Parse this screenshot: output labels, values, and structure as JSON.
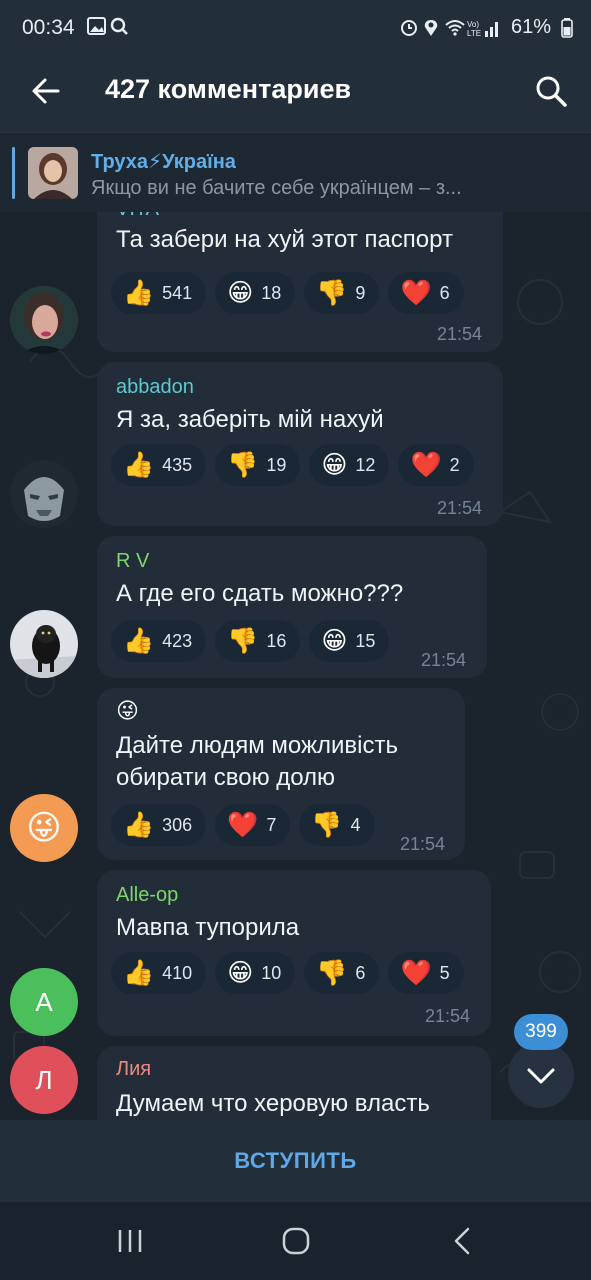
{
  "status": {
    "time": "00:34",
    "battery": "61%",
    "network": "LTE"
  },
  "header": {
    "title": "427 комментариев"
  },
  "pinned": {
    "channel": "Труха⚡Україна",
    "text": "Якщо ви не бачите себе українцем – з..."
  },
  "messages": [
    {
      "sender": "VITA",
      "sender_color": "#6cc8e0",
      "text": [
        "Та забери на хуй этот паспорт"
      ],
      "time": "21:54",
      "reactions": [
        {
          "emoji": "👍",
          "count": "541"
        },
        {
          "emoji": "😁",
          "count": "18"
        },
        {
          "emoji": "👎",
          "count": "9"
        },
        {
          "emoji": "❤️",
          "count": "6"
        }
      ]
    },
    {
      "sender": "abbadon",
      "sender_color": "#5fc8cf",
      "text": [
        "Я за, заберіть мій нахуй"
      ],
      "time": "21:54",
      "reactions": [
        {
          "emoji": "👍",
          "count": "435"
        },
        {
          "emoji": "👎",
          "count": "19"
        },
        {
          "emoji": "😁",
          "count": "12"
        },
        {
          "emoji": "❤️",
          "count": "2"
        }
      ]
    },
    {
      "sender": "R V",
      "sender_color": "#7ed66a",
      "text": [
        "А где его сдать можно???"
      ],
      "time": "21:54",
      "reactions": [
        {
          "emoji": "👍",
          "count": "423"
        },
        {
          "emoji": "👎",
          "count": "16"
        },
        {
          "emoji": "😁",
          "count": "15"
        }
      ]
    },
    {
      "sender": "😜",
      "sender_color": "#ffffff",
      "text": [
        "Дайте людям можливість",
        "обирати свою долю"
      ],
      "time": "21:54",
      "reactions": [
        {
          "emoji": "👍",
          "count": "306"
        },
        {
          "emoji": "❤️",
          "count": "7"
        },
        {
          "emoji": "👎",
          "count": "4"
        }
      ]
    },
    {
      "sender": "Alle-op",
      "sender_color": "#7ed66a",
      "text": [
        "Мавпа тупорила"
      ],
      "time": "21:54",
      "reactions": [
        {
          "emoji": "👍",
          "count": "410"
        },
        {
          "emoji": "😁",
          "count": "10"
        },
        {
          "emoji": "👎",
          "count": "6"
        },
        {
          "emoji": "❤️",
          "count": "5"
        }
      ]
    },
    {
      "sender": "Лия",
      "sender_color": "#f08a7e",
      "text": [
        "Думаем что херовую власть"
      ],
      "time": "",
      "reactions": []
    }
  ],
  "avatars": {
    "a": "A",
    "l": "Л",
    "emoji": "😜"
  },
  "scroll": {
    "unread": "399"
  },
  "footer": {
    "join": "ВСТУПИТЬ"
  },
  "colors": {
    "accent": "#5fa7e6",
    "bubble": "#222d39",
    "background": "#1b232d"
  }
}
